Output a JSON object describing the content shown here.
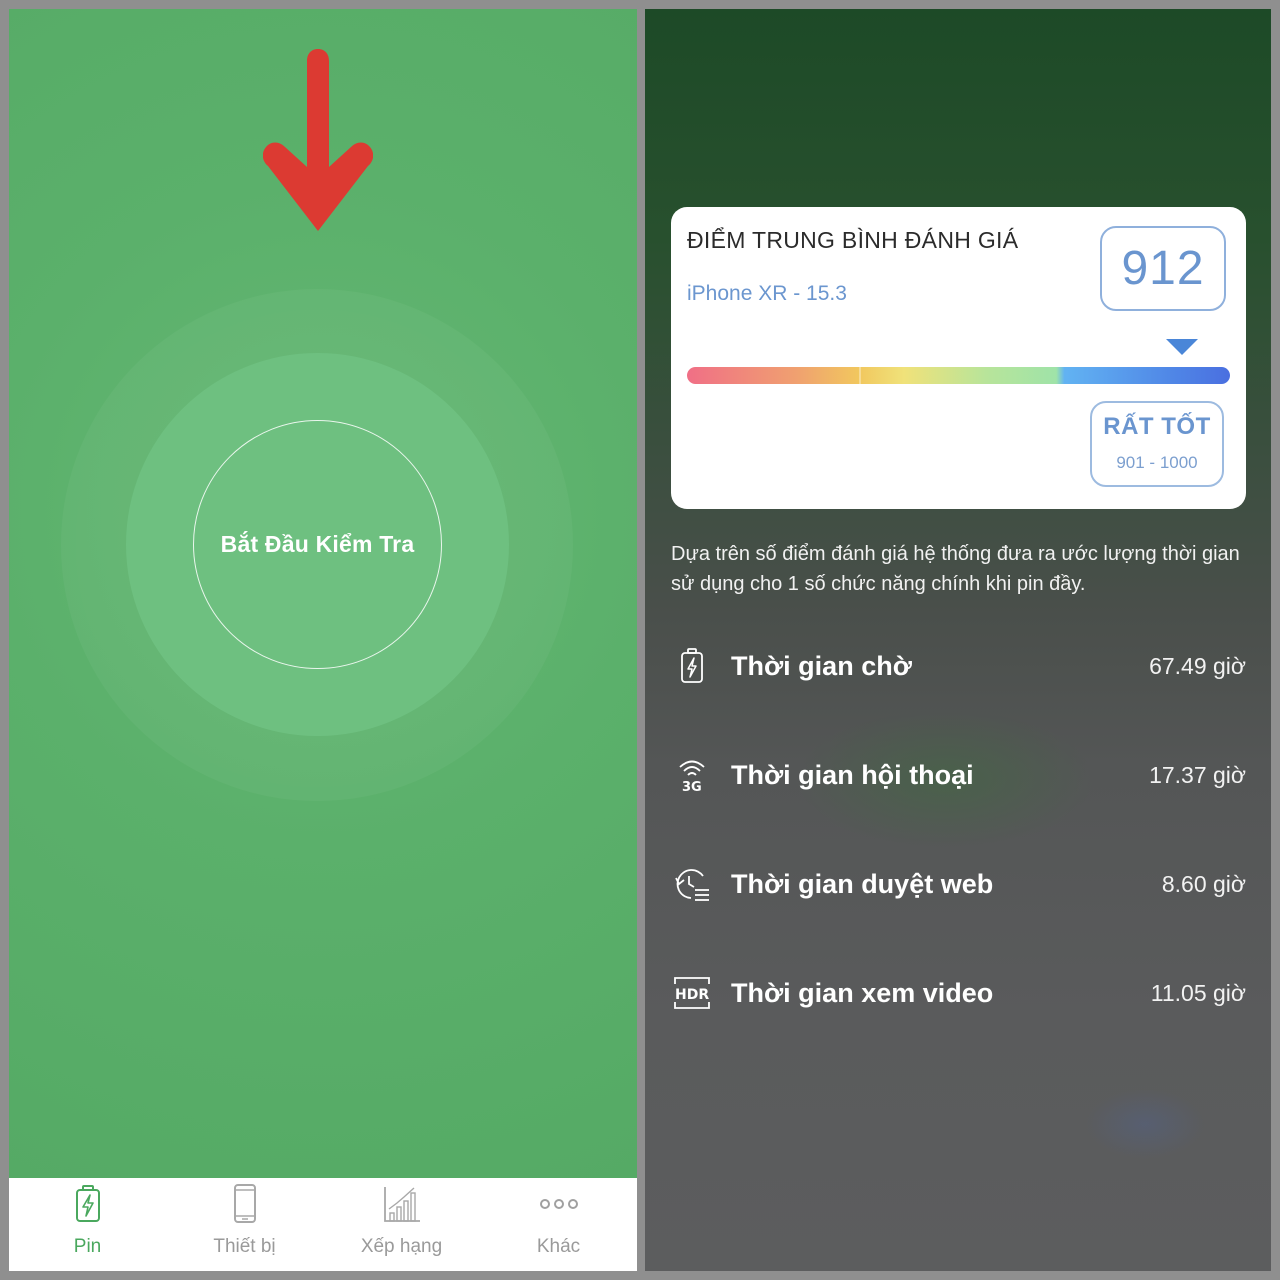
{
  "left": {
    "start_button_label": "Bắt Đầu Kiểm Tra",
    "accent_color": "#58ad68",
    "arrow_color": "#dc3a32",
    "tabs": [
      {
        "label": "Pin",
        "icon": "battery-icon",
        "active": true
      },
      {
        "label": "Thiết bị",
        "icon": "phone-icon",
        "active": false
      },
      {
        "label": "Xếp hạng",
        "icon": "ranking-chart-icon",
        "active": false
      },
      {
        "label": "Khác",
        "icon": "more-dots-icon",
        "active": false
      }
    ]
  },
  "right": {
    "card": {
      "title": "ĐIỂM TRUNG BÌNH ĐÁNH GIÁ",
      "device": "iPhone XR - 15.3",
      "score": "912",
      "grade_label": "RẤT TỐT",
      "grade_range": "901 - 1000",
      "score_fraction": 0.912
    },
    "description": "Dựa trên số điểm đánh giá hệ thống đưa ra ước lượng thời gian sử dụng cho 1 số chức năng chính khi pin đầy.",
    "metrics": [
      {
        "label": "Thời gian chờ",
        "value": "67.49 giờ",
        "icon": "battery-charging-icon"
      },
      {
        "label": "Thời gian hội thoại",
        "value": "17.37 giờ",
        "icon": "3g-signal-icon"
      },
      {
        "label": "Thời gian duyệt web",
        "value": "8.60 giờ",
        "icon": "history-clock-icon"
      },
      {
        "label": "Thời gian xem video",
        "value": "11.05 giờ",
        "icon": "hdr-icon"
      }
    ]
  }
}
